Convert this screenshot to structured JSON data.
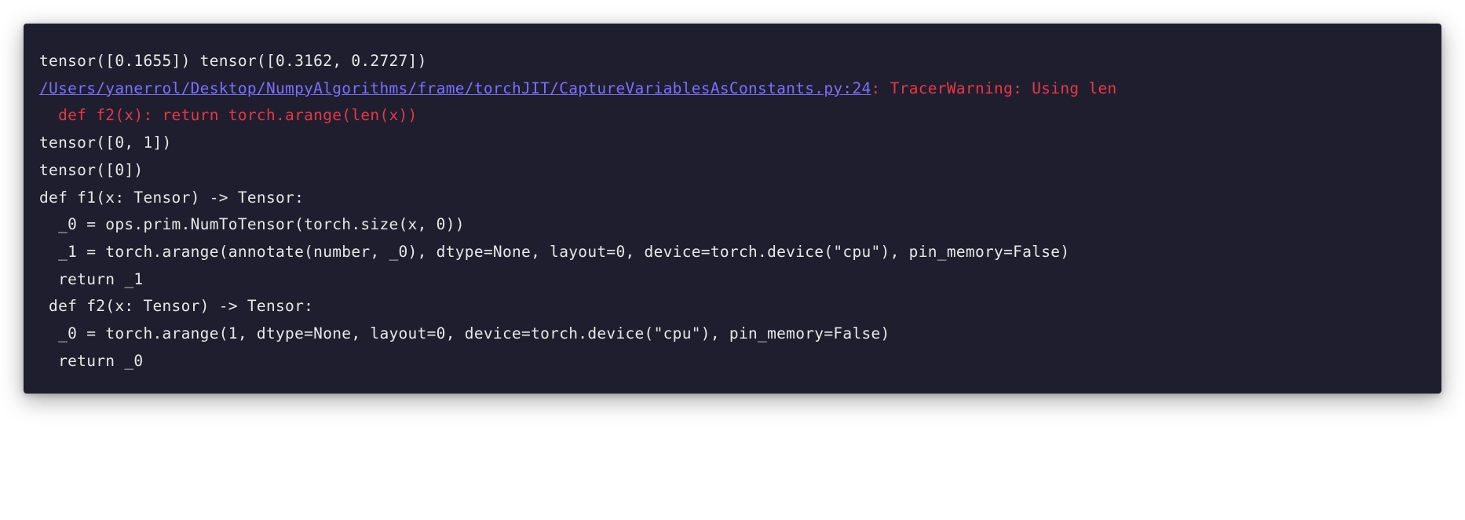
{
  "terminal": {
    "lines": [
      {
        "segments": [
          {
            "text": "tensor([0.1655]) tensor([0.3162, 0.2727])",
            "class": ""
          }
        ]
      },
      {
        "segments": [
          {
            "text": "/Users/yanerrol/Desktop/NumpyAlgorithms/frame/torchJIT/CaptureVariablesAsConstants.py:24",
            "class": "link"
          },
          {
            "text": ": TracerWarning: Using len",
            "class": "error-red"
          }
        ]
      },
      {
        "segments": [
          {
            "text": "  def f2(x): return torch.arange(len(x))",
            "class": "error-red"
          }
        ]
      },
      {
        "segments": [
          {
            "text": "tensor([0, 1])",
            "class": ""
          }
        ]
      },
      {
        "segments": [
          {
            "text": "tensor([0])",
            "class": ""
          }
        ]
      },
      {
        "segments": [
          {
            "text": "def f1(x: Tensor) -> Tensor:",
            "class": ""
          }
        ]
      },
      {
        "segments": [
          {
            "text": "  _0 = ops.prim.NumToTensor(torch.size(x, 0))",
            "class": ""
          }
        ]
      },
      {
        "segments": [
          {
            "text": "  _1 = torch.arange(annotate(number, _0), dtype=None, layout=0, device=torch.device(\"cpu\"), pin_memory=False)",
            "class": ""
          }
        ]
      },
      {
        "segments": [
          {
            "text": "  return _1",
            "class": ""
          }
        ]
      },
      {
        "segments": [
          {
            "text": " def f2(x: Tensor) -> Tensor:",
            "class": ""
          }
        ]
      },
      {
        "segments": [
          {
            "text": "  _0 = torch.arange(1, dtype=None, layout=0, device=torch.device(\"cpu\"), pin_memory=False)",
            "class": ""
          }
        ]
      },
      {
        "segments": [
          {
            "text": "  return _0",
            "class": ""
          }
        ]
      }
    ]
  }
}
